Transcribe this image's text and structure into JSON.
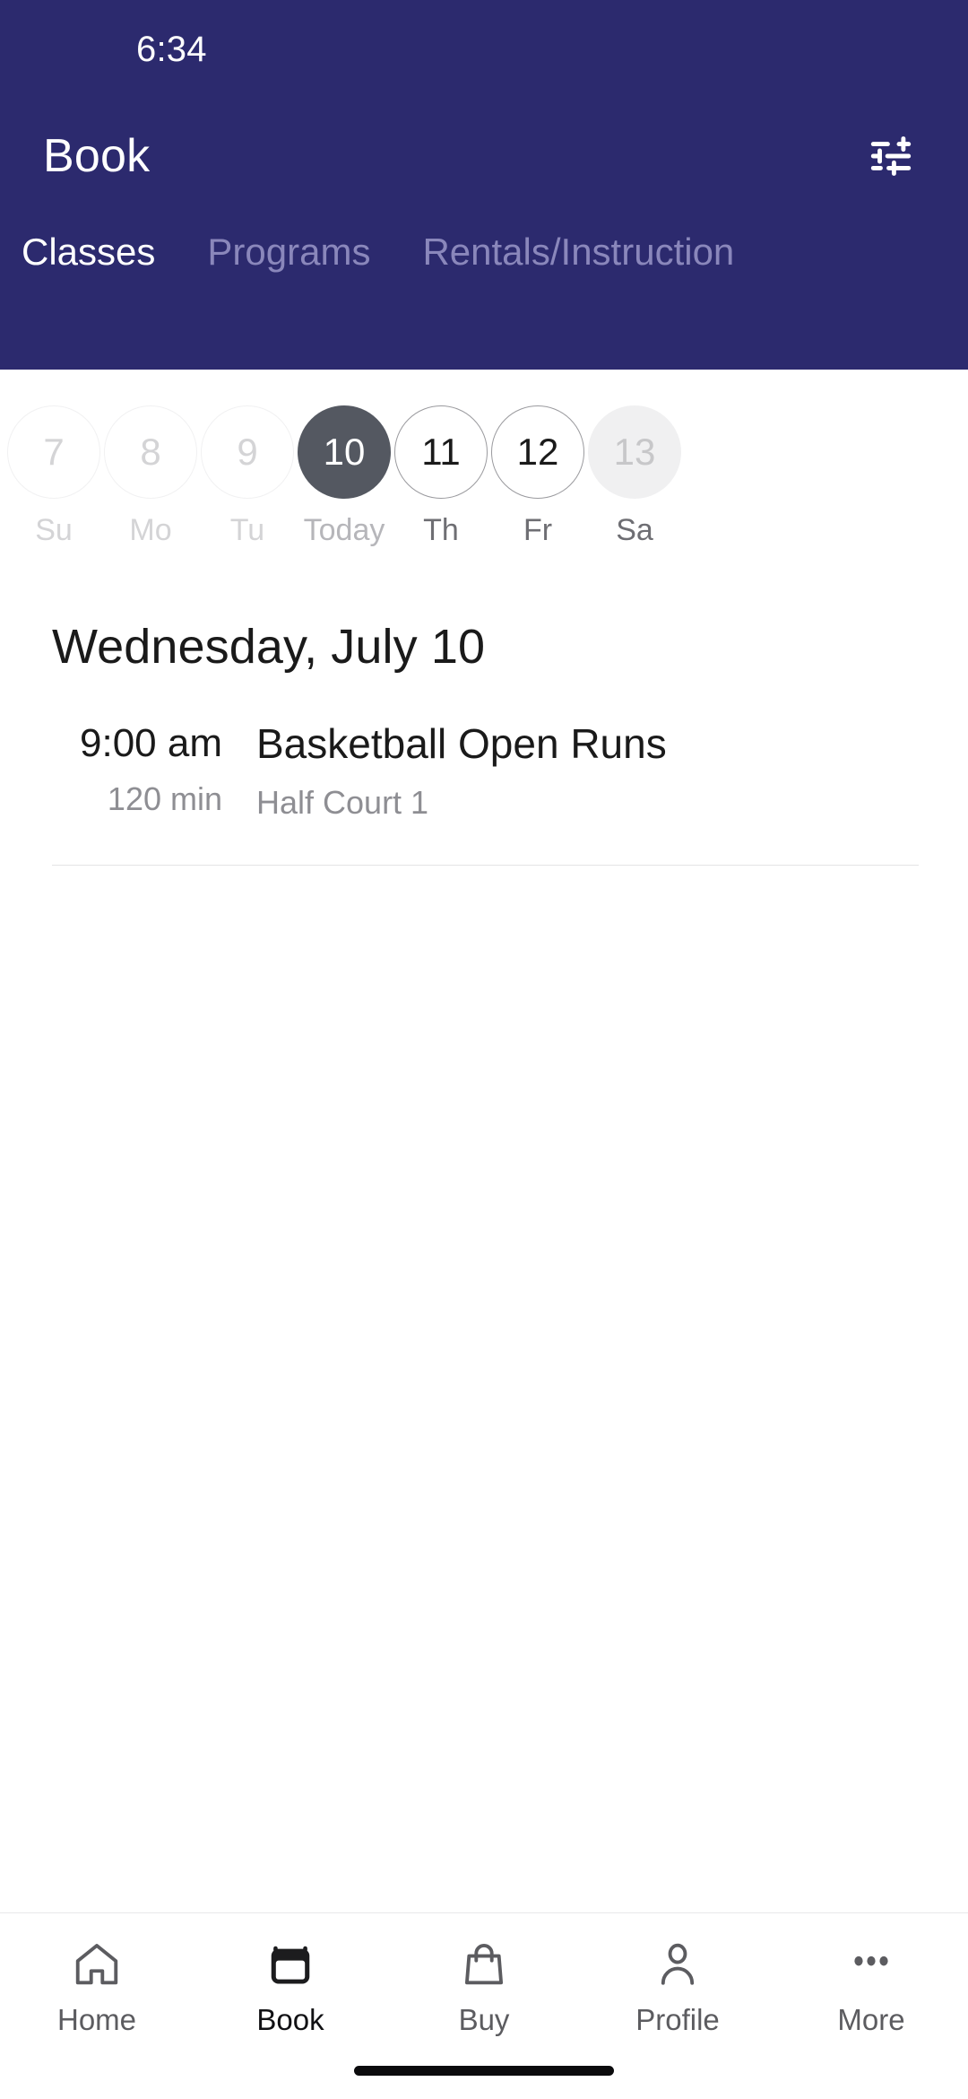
{
  "status_bar": {
    "time": "6:34"
  },
  "header": {
    "title": "Book",
    "filter_icon": "tune-sliders-icon",
    "background_color": "#2c2a6e",
    "tabs": [
      {
        "label": "Classes",
        "active": true
      },
      {
        "label": "Programs",
        "active": false
      },
      {
        "label": "Rentals/Instruction",
        "active": false
      }
    ]
  },
  "date_strip": {
    "days": [
      {
        "num": "7",
        "label": "Su",
        "state": "disabled"
      },
      {
        "num": "8",
        "label": "Mo",
        "state": "disabled"
      },
      {
        "num": "9",
        "label": "Tu",
        "state": "disabled"
      },
      {
        "num": "10",
        "label": "Today",
        "state": "selected"
      },
      {
        "num": "11",
        "label": "Th",
        "state": "available"
      },
      {
        "num": "12",
        "label": "Fr",
        "state": "available"
      },
      {
        "num": "13",
        "label": "Sa",
        "state": "filled"
      }
    ],
    "selected_color": "#545861"
  },
  "main": {
    "date_heading": "Wednesday, July 10",
    "classes": [
      {
        "time": "9:00 am",
        "duration": "120 min",
        "title": "Basketball Open Runs",
        "location": "Half Court 1"
      }
    ]
  },
  "bottom_nav": {
    "items": [
      {
        "label": "Home",
        "icon": "home-icon",
        "active": false
      },
      {
        "label": "Book",
        "icon": "calendar-icon",
        "active": true
      },
      {
        "label": "Buy",
        "icon": "shopping-bag-icon",
        "active": false
      },
      {
        "label": "Profile",
        "icon": "person-icon",
        "active": false
      },
      {
        "label": "More",
        "icon": "ellipsis-icon",
        "active": false
      }
    ]
  }
}
